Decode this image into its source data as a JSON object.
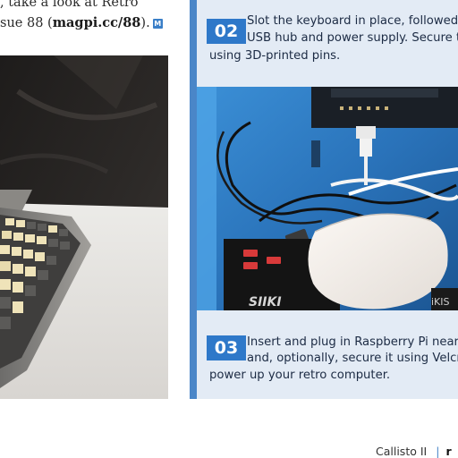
{
  "left_column": {
    "line1": ", take a look at Retro",
    "line2_prefix": "sue 88 (",
    "line2_link": "magpi.cc/88",
    "line2_suffix": ").",
    "end_mark": "M"
  },
  "steps": [
    {
      "number": "02",
      "line1": "Slot the keyboard in place, followed",
      "line2": "USB hub and power supply. Secure t",
      "line3": "using 3D-printed pins."
    },
    {
      "number": "03",
      "line1": "Insert and plug in Raspberry Pi near t",
      "line2": "and, optionally, secure it using Velcro",
      "line3": "power up your retro computer."
    }
  ],
  "photo_text": {
    "hub_brand": "SIIKI",
    "hub_brand_2": "iKIS"
  },
  "footer": {
    "title": "Callisto II",
    "separator": "|",
    "next": "r"
  },
  "colors": {
    "accent": "#2e78c9",
    "panel": "#e3ebf5"
  }
}
